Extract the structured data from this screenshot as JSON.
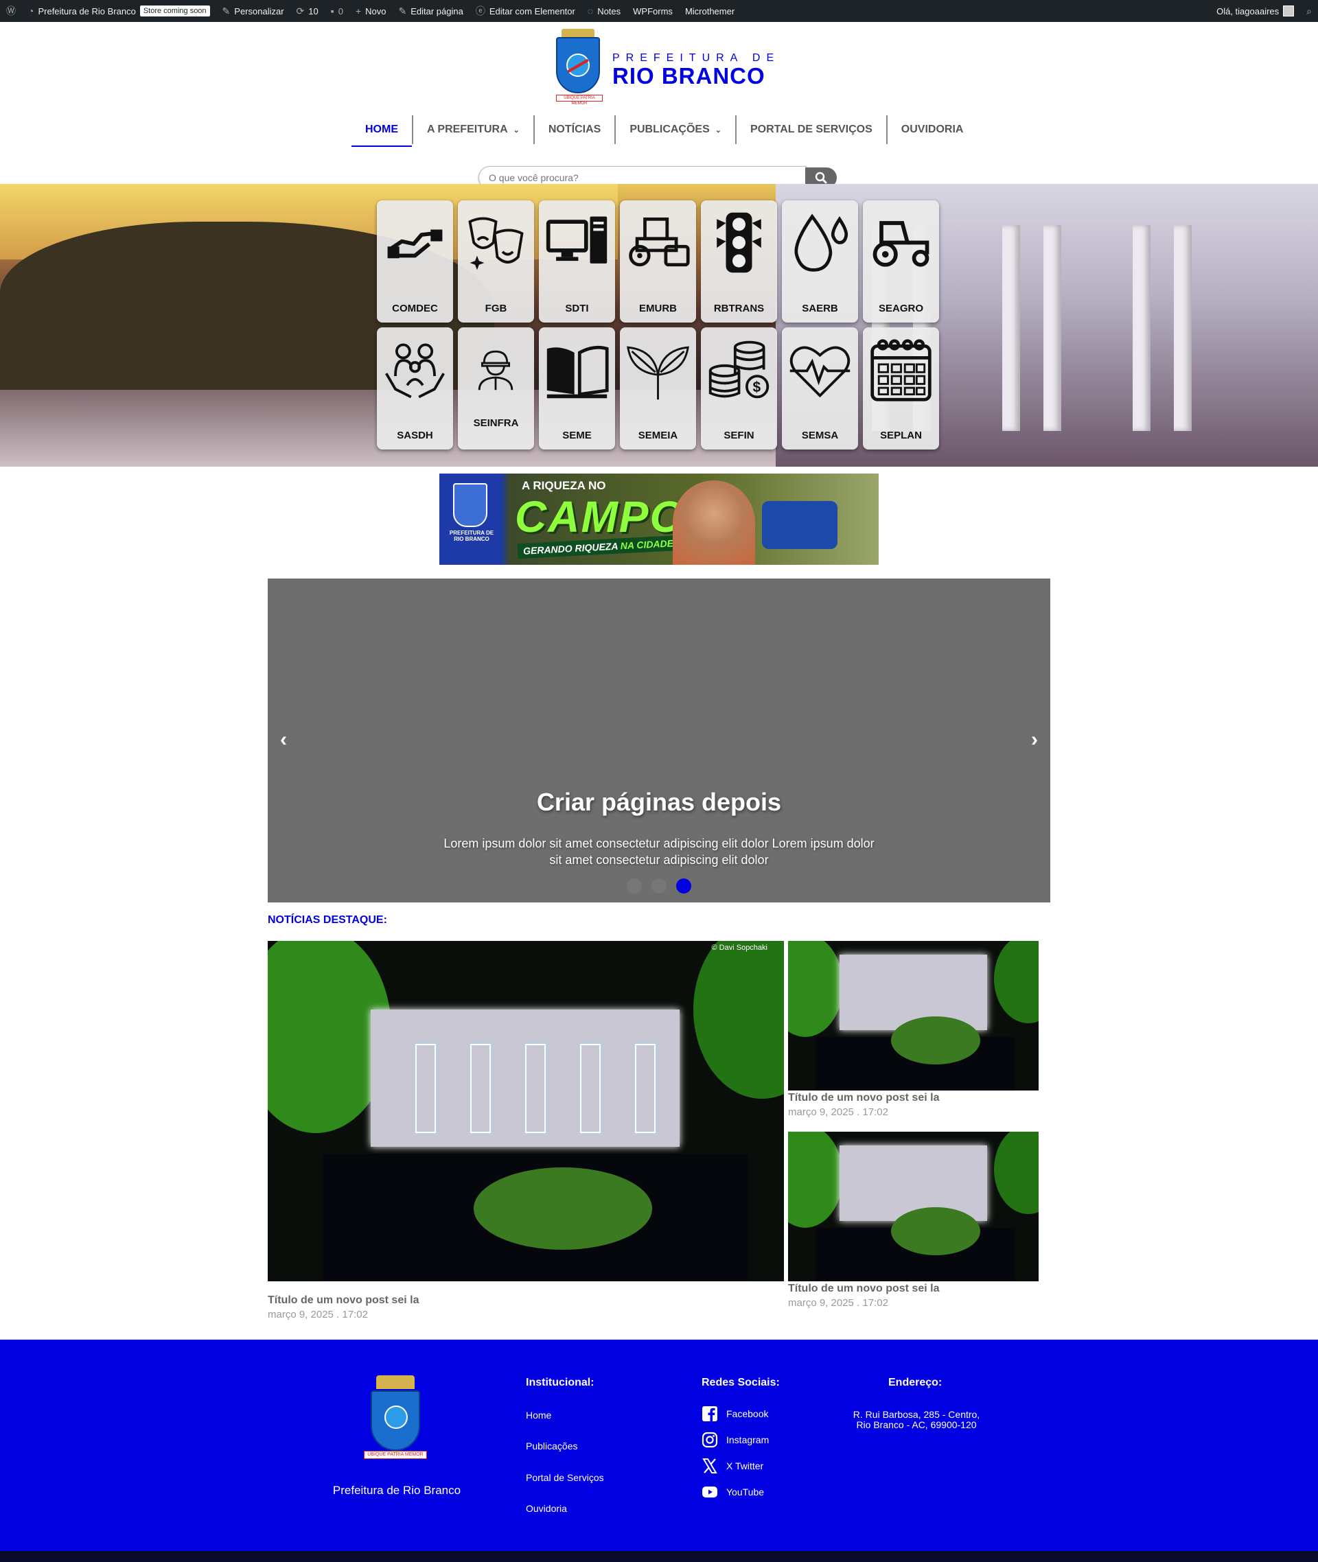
{
  "adminbar": {
    "site_name": "Prefeitura de Rio Branco",
    "badge": "Store coming soon",
    "customize": "Personalizar",
    "updates": "10",
    "comments": "0",
    "new": "Novo",
    "edit_page": "Editar página",
    "edit_elementor": "Editar com Elementor",
    "notes": "Notes",
    "wpforms": "WPForms",
    "microthemer": "Microthemer",
    "greeting": "Olá, tiagoaaires"
  },
  "logo": {
    "line1": "PREFEITURA DE",
    "line2": "RIO BRANCO",
    "ribbon": "UBIQUE PATRIA MEMOR"
  },
  "nav": {
    "items": [
      {
        "label": "HOME",
        "active": true,
        "dropdown": false
      },
      {
        "label": "A PREFEITURA",
        "active": false,
        "dropdown": true
      },
      {
        "label": "NOTÍCIAS",
        "active": false,
        "dropdown": false
      },
      {
        "label": "PUBLICAÇÕES",
        "active": false,
        "dropdown": true
      },
      {
        "label": "PORTAL DE SERVIÇOS",
        "active": false,
        "dropdown": false
      },
      {
        "label": "OUVIDORIA",
        "active": false,
        "dropdown": false
      }
    ]
  },
  "search": {
    "placeholder": "O que você procura?"
  },
  "services": [
    {
      "label": "COMDEC",
      "icon": "handshake-icon"
    },
    {
      "label": "FGB",
      "icon": "theater-masks-icon"
    },
    {
      "label": "SDTI",
      "icon": "computer-icon"
    },
    {
      "label": "EMURB",
      "icon": "road-roller-icon"
    },
    {
      "label": "RBTRANS",
      "icon": "traffic-light-icon"
    },
    {
      "label": "SAERB",
      "icon": "water-drop-icon"
    },
    {
      "label": "SEAGRO",
      "icon": "tractor-icon"
    },
    {
      "label": "SASDH",
      "icon": "family-care-icon"
    },
    {
      "label": "SEINFRA",
      "icon": "construction-worker-icon"
    },
    {
      "label": "SEME",
      "icon": "open-book-icon"
    },
    {
      "label": "SEMEIA",
      "icon": "leaves-icon"
    },
    {
      "label": "SEFIN",
      "icon": "coins-icon"
    },
    {
      "label": "SEMSA",
      "icon": "heartbeat-icon"
    },
    {
      "label": "SEPLAN",
      "icon": "calendar-icon"
    }
  ],
  "banner": {
    "top": "A RIQUEZA NO",
    "big": "CAMPO",
    "tag_a": "GERANDO RIQUEZA",
    "tag_b": "NA CIDADE.",
    "org": "PREFEITURA DE RIO BRANCO"
  },
  "slider": {
    "title": "Criar páginas depois",
    "text": "Lorem ipsum dolor sit amet consectetur adipiscing elit dolor Lorem ipsum dolor sit amet consectetur adipiscing elit dolor",
    "slides": 3,
    "active_slide": 3
  },
  "news": {
    "heading": "NOTÍCIAS DESTAQUE:",
    "credit": "© Davi Sopchaki",
    "items": [
      {
        "title": "Título de um novo post sei la",
        "date": "março 9, 2025 . 17:02"
      },
      {
        "title": "Título de um novo post sei la",
        "date": "março 9, 2025 . 17:02"
      },
      {
        "title": "Título de um novo post sei la",
        "date": "março 9, 2025 . 17:02"
      }
    ]
  },
  "footer": {
    "name": "Prefeitura de Rio Branco",
    "ribbon": "UBIQUE PATRIA MEMOR",
    "institutional": {
      "heading": "Institucional:",
      "links": [
        "Home",
        "Publicações",
        "Portal de Serviços",
        "Ouvidoria"
      ]
    },
    "social": {
      "heading": "Redes Sociais:",
      "links": [
        {
          "label": "Facebook",
          "icon": "facebook-icon"
        },
        {
          "label": "Instagram",
          "icon": "instagram-icon"
        },
        {
          "label": "X Twitter",
          "icon": "x-twitter-icon"
        },
        {
          "label": "YouTube",
          "icon": "youtube-icon"
        }
      ]
    },
    "address": {
      "heading": "Endereço:",
      "line1": "R. Rui Barbosa, 285 - Centro,",
      "line2": "Rio Branco - AC, 69900-120"
    }
  },
  "colors": {
    "brand_blue": "#0000e0",
    "admin_bar": "#1d2327",
    "slider_bg": "#6e6e6e"
  }
}
